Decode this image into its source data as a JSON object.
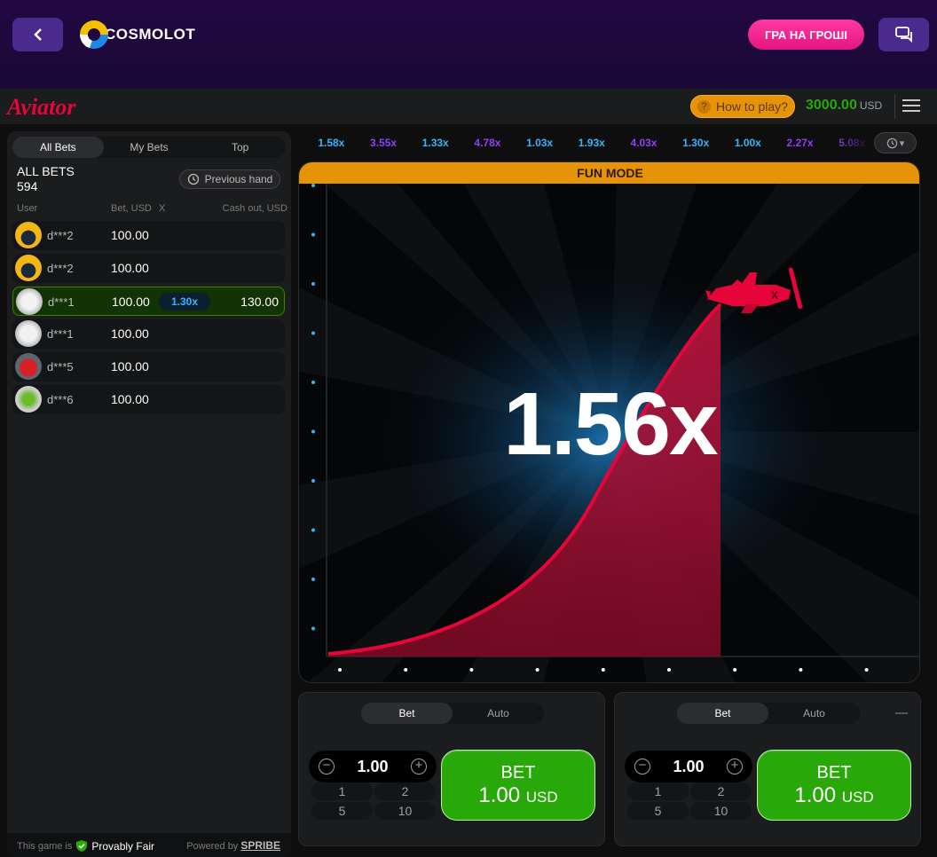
{
  "header": {
    "logo_text": "COSMOLOT",
    "play_money_label": "ГРА НА ГРОШІ"
  },
  "game_bar": {
    "game_name": "Aviator",
    "how_to_play": "How to play?",
    "balance": "3000.00",
    "currency": "USD"
  },
  "bets_panel": {
    "tabs": [
      "All Bets",
      "My Bets",
      "Top"
    ],
    "title": "ALL BETS",
    "count": "594",
    "previous_hand": "Previous hand",
    "columns": {
      "user": "User",
      "bet": "Bet, USD",
      "x": "X",
      "cashout": "Cash out, USD"
    },
    "rows": [
      {
        "user": "d***2",
        "bet": "100.00",
        "mult": "",
        "cashout": ""
      },
      {
        "user": "d***2",
        "bet": "100.00",
        "mult": "",
        "cashout": ""
      },
      {
        "user": "d***1",
        "bet": "100.00",
        "mult": "1.30x",
        "cashout": "130.00"
      },
      {
        "user": "d***1",
        "bet": "100.00",
        "mult": "",
        "cashout": ""
      },
      {
        "user": "d***5",
        "bet": "100.00",
        "mult": "",
        "cashout": ""
      },
      {
        "user": "d***6",
        "bet": "100.00",
        "mult": "",
        "cashout": ""
      }
    ],
    "footer": {
      "prefix": "This game is",
      "provably_fair": "Provably Fair",
      "powered_by": "Powered by",
      "provider": "SPRIBE"
    }
  },
  "history": [
    {
      "v": "1.58x",
      "c": "#34b4ff"
    },
    {
      "v": "3.55x",
      "c": "#913ef8"
    },
    {
      "v": "1.33x",
      "c": "#34b4ff"
    },
    {
      "v": "4.78x",
      "c": "#913ef8"
    },
    {
      "v": "1.03x",
      "c": "#34b4ff"
    },
    {
      "v": "1.93x",
      "c": "#34b4ff"
    },
    {
      "v": "4.03x",
      "c": "#913ef8"
    },
    {
      "v": "1.30x",
      "c": "#34b4ff"
    },
    {
      "v": "1.00x",
      "c": "#34b4ff"
    },
    {
      "v": "2.27x",
      "c": "#913ef8"
    },
    {
      "v": "5.08x",
      "c": "#913ef8"
    }
  ],
  "stage": {
    "mode_banner": "FUN MODE",
    "multiplier": "1.56x"
  },
  "bet_panels": [
    {
      "tabs": [
        "Bet",
        "Auto"
      ],
      "amount": "1.00",
      "quick": [
        "1",
        "2",
        "5",
        "10"
      ],
      "bet_label": "BET",
      "bet_amount": "1.00",
      "bet_currency": "USD"
    },
    {
      "tabs": [
        "Bet",
        "Auto"
      ],
      "amount": "1.00",
      "quick": [
        "1",
        "2",
        "5",
        "10"
      ],
      "bet_label": "BET",
      "bet_amount": "1.00",
      "bet_currency": "USD"
    }
  ],
  "colors": {
    "accent_red": "#e50539",
    "win_green": "#28a909",
    "blue_mult": "#34b4ff",
    "purple_mult": "#913ef8",
    "orange": "#e69308"
  }
}
